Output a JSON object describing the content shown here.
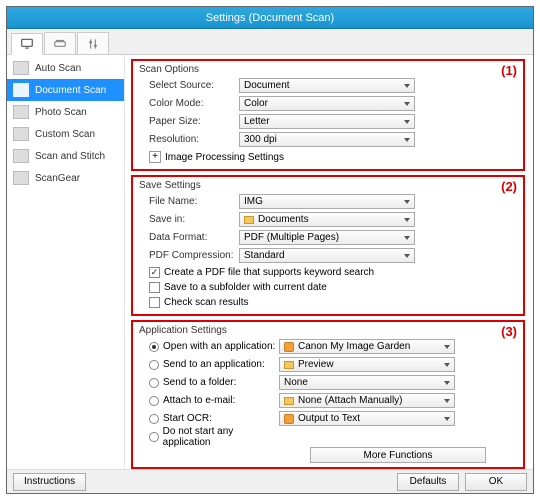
{
  "window": {
    "title": "Settings (Document Scan)"
  },
  "sidebar": {
    "items": [
      {
        "label": "Auto Scan"
      },
      {
        "label": "Document Scan"
      },
      {
        "label": "Photo Scan"
      },
      {
        "label": "Custom Scan"
      },
      {
        "label": "Scan and Stitch"
      },
      {
        "label": "ScanGear"
      }
    ]
  },
  "regions": {
    "r1": "(1)",
    "r2": "(2)",
    "r3": "(3)"
  },
  "scan_options": {
    "title": "Scan Options",
    "select_source": {
      "label": "Select Source:",
      "value": "Document"
    },
    "color_mode": {
      "label": "Color Mode:",
      "value": "Color"
    },
    "paper_size": {
      "label": "Paper Size:",
      "value": "Letter"
    },
    "resolution": {
      "label": "Resolution:",
      "value": "300 dpi"
    },
    "image_processing": {
      "label": "Image Processing Settings",
      "expander": "+"
    }
  },
  "save_settings": {
    "title": "Save Settings",
    "file_name": {
      "label": "File Name:",
      "value": "IMG"
    },
    "save_in": {
      "label": "Save in:",
      "value": "Documents"
    },
    "data_format": {
      "label": "Data Format:",
      "value": "PDF (Multiple Pages)"
    },
    "pdf_compression": {
      "label": "PDF Compression:",
      "value": "Standard"
    },
    "checkboxes": {
      "keyword_pdf": {
        "label": "Create a PDF file that supports keyword search",
        "checked": true
      },
      "subfolder": {
        "label": "Save to a subfolder with current date",
        "checked": false
      },
      "check_results": {
        "label": "Check scan results",
        "checked": false
      }
    }
  },
  "app_settings": {
    "title": "Application Settings",
    "options": [
      {
        "label": "Open with an application:",
        "value": "Canon My Image Garden",
        "checked": true,
        "icon": "app"
      },
      {
        "label": "Send to an application:",
        "value": "Preview",
        "checked": false,
        "icon": "folder"
      },
      {
        "label": "Send to a folder:",
        "value": "None",
        "checked": false,
        "icon": ""
      },
      {
        "label": "Attach to e-mail:",
        "value": "None (Attach Manually)",
        "checked": false,
        "icon": "folder"
      },
      {
        "label": "Start OCR:",
        "value": "Output to Text",
        "checked": false,
        "icon": "app"
      },
      {
        "label": "Do not start any application",
        "value": "",
        "checked": false,
        "icon": ""
      }
    ],
    "more_functions": "More Functions"
  },
  "footer": {
    "instructions": "Instructions",
    "defaults": "Defaults",
    "ok": "OK"
  }
}
